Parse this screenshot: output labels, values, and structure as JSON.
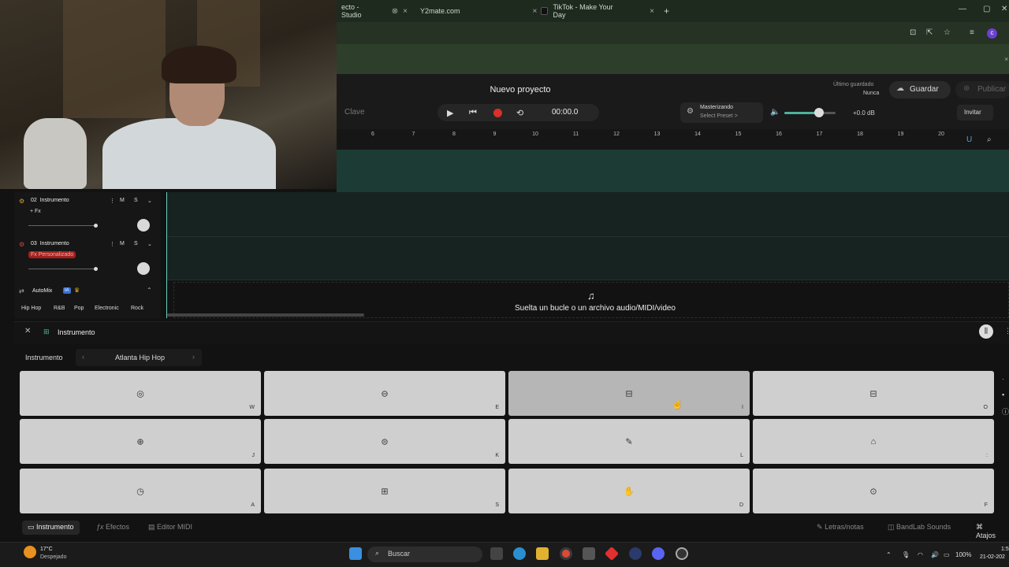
{
  "browser": {
    "tabs": [
      {
        "title": "ecto - Studio",
        "close": "⊗"
      },
      {
        "title": "Y2mate.com",
        "close": "×"
      },
      {
        "title": "TikTok - Make Your Day",
        "close": "×"
      }
    ],
    "new_tab": "+",
    "profile_initial": "c"
  },
  "header": {
    "project_title": "Nuevo proyecto",
    "key_label": "Clave",
    "time": "00:00.0",
    "mastering_title": "Masterizando",
    "mastering_preset": "Select Preset >",
    "volume_db": "+0.0 dB",
    "volume_level": 0.6,
    "last_saved_label": "Último guardado",
    "last_saved_value": "Nunca",
    "save_label": "Guardar",
    "publish_label": "Publicar",
    "invite_label": "Invitar"
  },
  "ruler": {
    "bars": [
      "6",
      "7",
      "8",
      "9",
      "10",
      "11",
      "12",
      "13",
      "14",
      "15",
      "16",
      "17",
      "18",
      "19",
      "20"
    ]
  },
  "tracks": [
    {
      "number": "02",
      "name": "Instrumento",
      "fx": "+ Fx",
      "mute": "M",
      "solo": "S"
    },
    {
      "number": "03",
      "name": "Instrumento",
      "fx": "Fx Personalizado",
      "mute": "M",
      "solo": "S"
    }
  ],
  "automix": {
    "label": "AutoMix",
    "badge": "IA",
    "genres": [
      "Hip Hop",
      "R&B",
      "Pop",
      "Electronic",
      "Rock"
    ]
  },
  "drop_zone": {
    "text": "Suelta un bucle o un archivo audio/MIDI/video"
  },
  "instrument_panel": {
    "title": "Instrumento",
    "instrument_label": "Instrumento",
    "preset_name": "Atlanta Hip Hop",
    "pads": [
      {
        "icon": "kick-drum-icon",
        "glyph": "◎",
        "key": "W"
      },
      {
        "icon": "snare-icon",
        "glyph": "⊖",
        "key": "E"
      },
      {
        "icon": "tom-icon",
        "glyph": "⊟",
        "key": "I"
      },
      {
        "icon": "floor-tom-icon",
        "glyph": "⊟",
        "key": "O"
      },
      {
        "icon": "hihat-icon",
        "glyph": "⊕",
        "key": "J"
      },
      {
        "icon": "snare-side-icon",
        "glyph": "⊜",
        "key": "K"
      },
      {
        "icon": "stick-icon",
        "glyph": "✎",
        "key": "L"
      },
      {
        "icon": "cowbell-icon",
        "glyph": "⌂",
        "key": ":"
      },
      {
        "icon": "timer-icon",
        "glyph": "◷",
        "key": "A"
      },
      {
        "icon": "drum-icon",
        "glyph": "⊞",
        "key": "S"
      },
      {
        "icon": "clap-icon",
        "glyph": "✋",
        "key": "D"
      },
      {
        "icon": "conga-icon",
        "glyph": "⊙",
        "key": "F"
      }
    ]
  },
  "bottom_tabs": {
    "instrument": "Instrumento",
    "effects": "Efectos",
    "midi_editor": "Editor MIDI",
    "lyrics": "Letras/notas",
    "sounds": "BandLab Sounds",
    "shortcuts": "Atajos"
  },
  "taskbar": {
    "temperature": "17°C",
    "weather": "Despejado",
    "search_placeholder": "Buscar",
    "battery": "100%",
    "time": "1:5",
    "date": "21-02-202"
  },
  "colors": {
    "accent_teal": "#4cb39b",
    "record_red": "#d9302a",
    "lane_teal": "#1d3b35"
  }
}
